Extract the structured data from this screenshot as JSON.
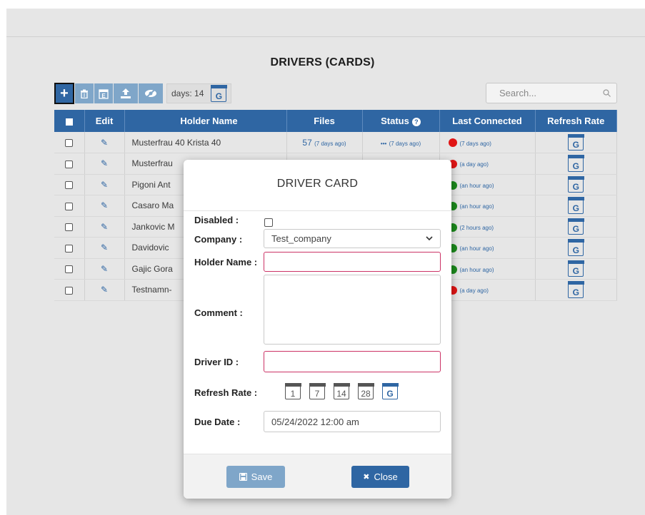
{
  "page": {
    "title": "DRIVERS (CARDS)"
  },
  "toolbar": {
    "days_label": "days: 14"
  },
  "search": {
    "placeholder": "Search..."
  },
  "table": {
    "headers": {
      "edit": "Edit",
      "holder": "Holder Name",
      "files": "Files",
      "status": "Status",
      "last": "Last Connected",
      "rate": "Refresh Rate"
    },
    "rows": [
      {
        "name": "Musterfrau 40 Krista 40",
        "files": "57",
        "files_ago": "(7 days ago)",
        "status": "•••",
        "status_ago": "(7 days ago)",
        "dot": "red",
        "last": "(7 days ago)"
      },
      {
        "name": "Musterfrau",
        "files": "",
        "files_ago": "",
        "status": "",
        "status_ago": "",
        "dot": "red",
        "last": "(a day ago)"
      },
      {
        "name": "Pigoni Ant",
        "files": "",
        "files_ago": "",
        "status": "",
        "status_ago": "",
        "dot": "green",
        "last": "(an hour ago)"
      },
      {
        "name": "Casaro Ma",
        "files": "",
        "files_ago": "",
        "status": "",
        "status_ago": "",
        "dot": "green",
        "last": "(an hour ago)"
      },
      {
        "name": "Jankovic M",
        "files": "",
        "files_ago": "",
        "status": "",
        "status_ago": "",
        "dot": "green",
        "last": "(2 hours ago)"
      },
      {
        "name": "Davidovic",
        "files": "",
        "files_ago": "",
        "status": "",
        "status_ago": "",
        "dot": "green",
        "last": "(an hour ago)"
      },
      {
        "name": "Gajic Gora",
        "files": "",
        "files_ago": "",
        "status": "",
        "status_ago": "",
        "dot": "green",
        "last": "(an hour ago)"
      },
      {
        "name": "Testnamn-",
        "files": "",
        "files_ago": "",
        "status": "",
        "status_ago": "",
        "dot": "red",
        "last": "(a day ago)"
      }
    ],
    "rate_icon_label": "G"
  },
  "modal": {
    "title": "DRIVER CARD",
    "labels": {
      "disabled": "Disabled :",
      "company": "Company :",
      "holder": "Holder Name :",
      "comment": "Comment :",
      "driver_id": "Driver ID :",
      "refresh": "Refresh Rate :",
      "due": "Due Date :"
    },
    "company_value": "Test_company",
    "due_value": "05/24/2022 12:00 am",
    "refresh_options": [
      "1",
      "7",
      "14",
      "28",
      "G"
    ],
    "save": "Save",
    "close": "Close"
  },
  "colors": {
    "primary": "#2f66a3",
    "primary_light": "#7fa6c9",
    "red": "#e01515",
    "green": "#1c8a1c",
    "required_border": "#cc3366"
  }
}
